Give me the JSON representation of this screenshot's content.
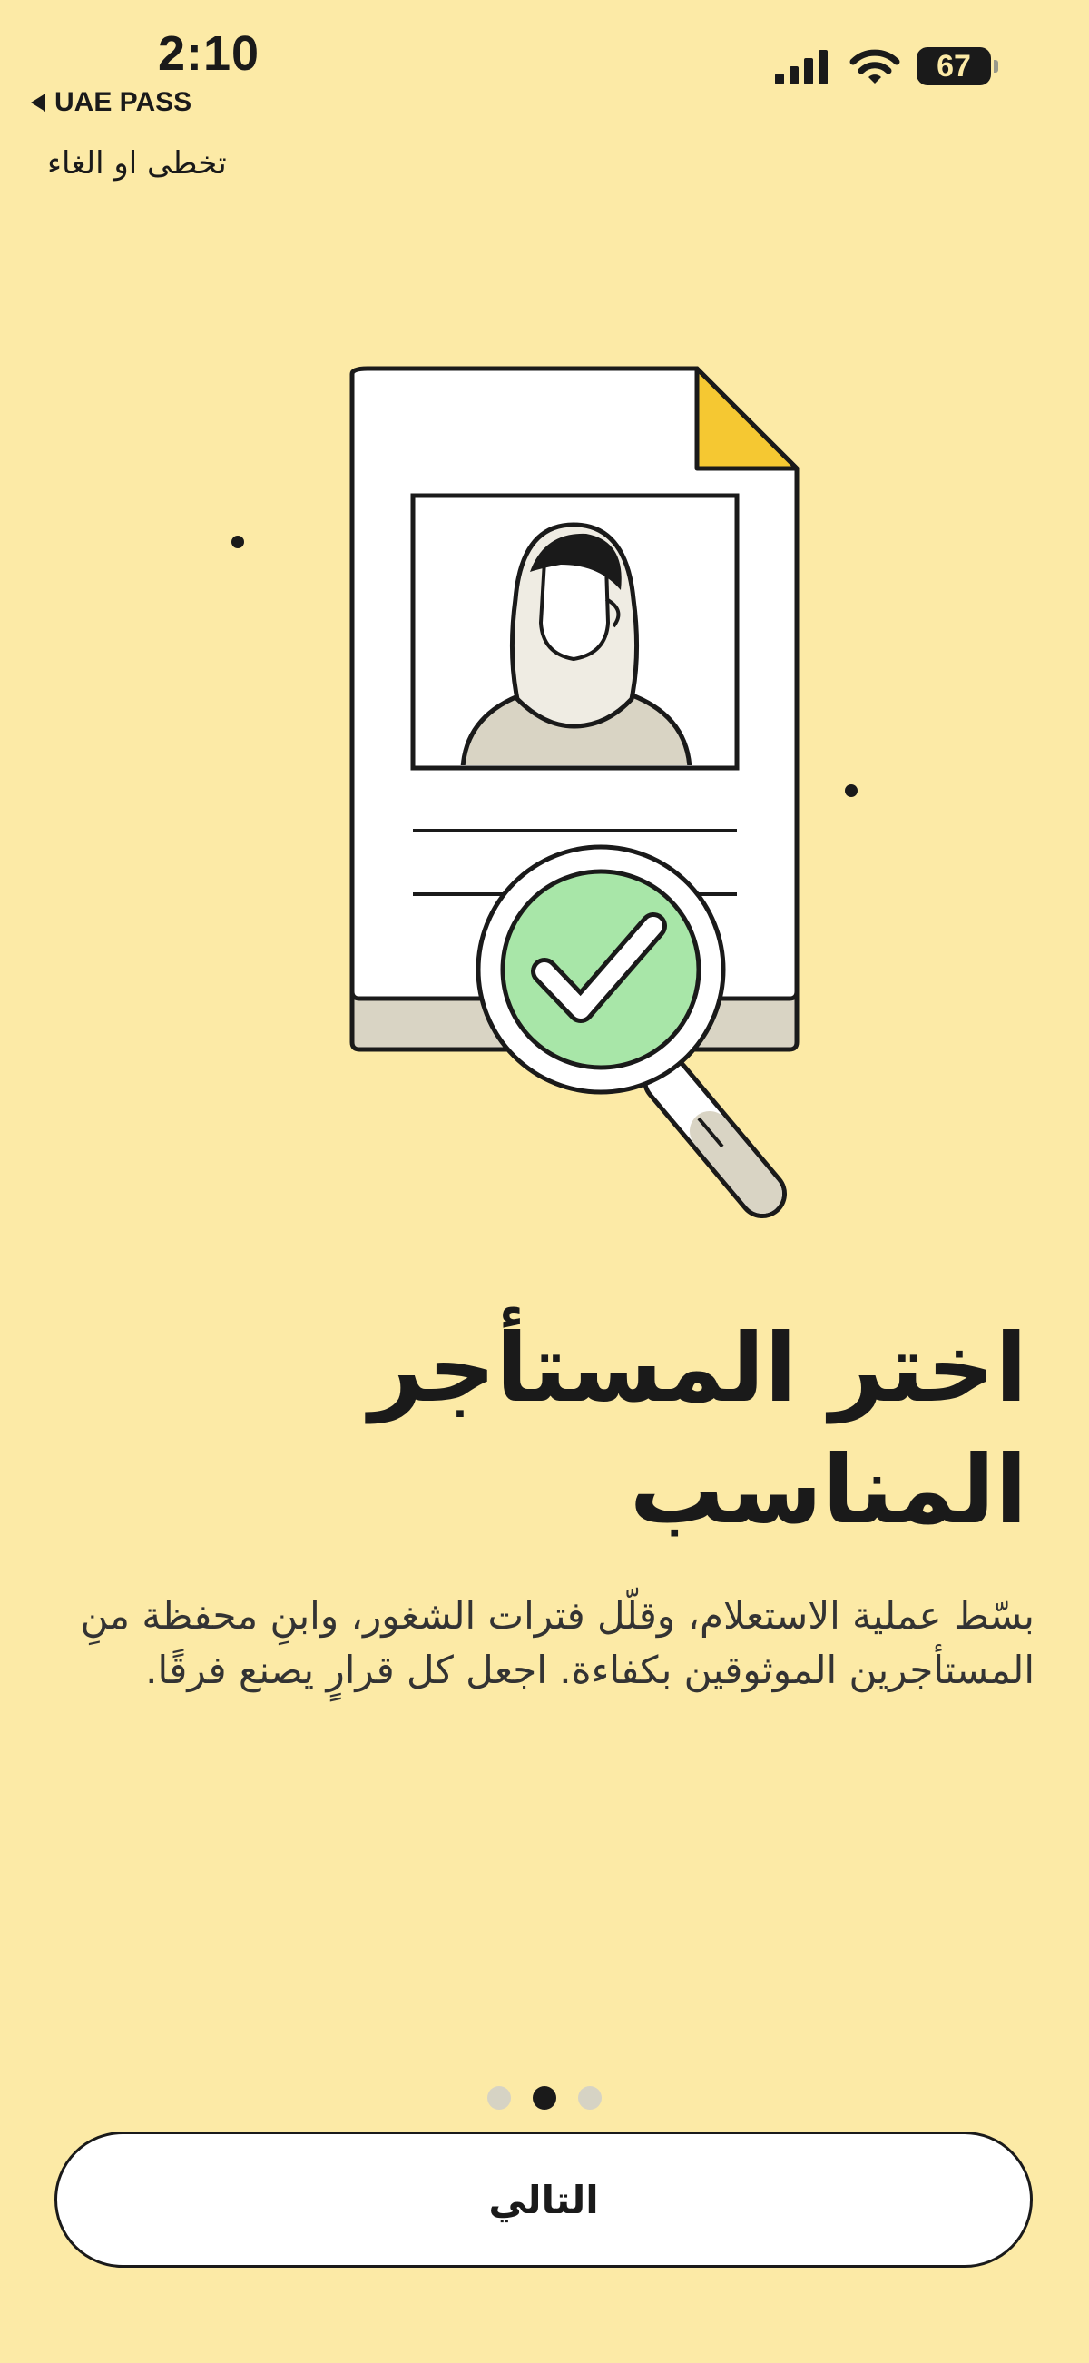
{
  "status_bar": {
    "time": "2:10",
    "back_app": "UAE PASS",
    "battery": "67"
  },
  "skip_label": "تخطى او الغاء",
  "illustration": {
    "icons": [
      "document-icon",
      "user-photo-icon",
      "magnifier-icon",
      "checkmark-icon"
    ]
  },
  "headline": "اختر المستأجر المناسب",
  "description": "بسّط عملية الاستعلام، وقلّل فترات الشغور، وابنِ محفظة منِ المستأجرين الموثوقين بكفاءة. اجعل كل قرارٍ يصنع فرقًا.",
  "pager": {
    "total": 3,
    "active_index": 1
  },
  "next_label": "التالي",
  "colors": {
    "background": "#FCEAA6",
    "accent_yellow": "#F5C832",
    "check_green": "#A8E6A8",
    "ink": "#1A1A1A"
  }
}
